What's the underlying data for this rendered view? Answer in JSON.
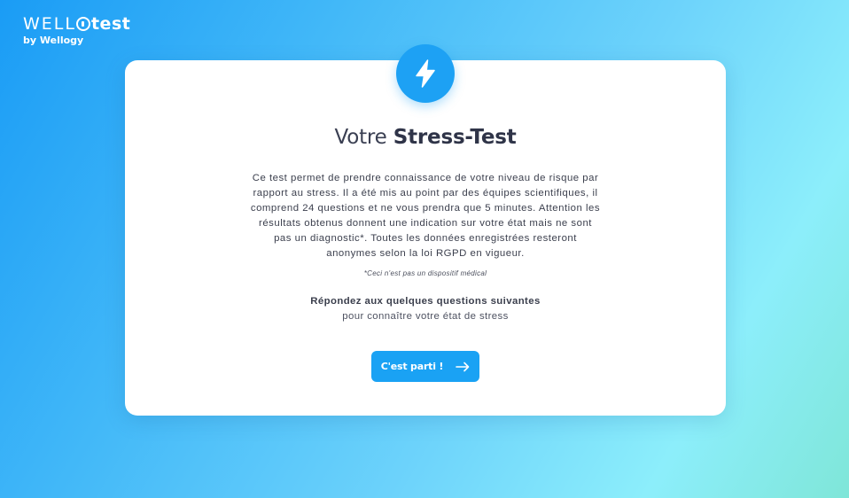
{
  "brand": {
    "name_part1": "WELL",
    "name_part2": "test",
    "icon": "wello-logo-mark",
    "subtitle": "by Wellogy"
  },
  "card": {
    "badge_icon": "lightning-bolt-icon",
    "title_regular": "Votre",
    "title_bold": "Stress-Test",
    "description": "Ce test permet de prendre connaissance de votre niveau de risque par rapport au stress. Il a été mis au point par des équipes scientifiques, il comprend 24 questions et ne vous prendra que 5 minutes. Attention les résultats obtenus donnent une indication sur votre état mais ne sont pas un diagnostic*. Toutes les données enregistrées resteront anonymes selon la loi RGPD en vigueur.",
    "disclaimer": "*Ceci n'est pas un dispositif médical",
    "prompt": "Répondez aux quelques questions suivantes",
    "subprompt": "pour connaître votre état de stress",
    "start_button_label": "C'est parti !",
    "start_button_icon": "arrow-right-icon"
  },
  "colors": {
    "accent": "#1da1f4",
    "background_start": "#1a9cf5",
    "background_end": "#7fe6d8",
    "text_dark": "#3a3f52"
  }
}
